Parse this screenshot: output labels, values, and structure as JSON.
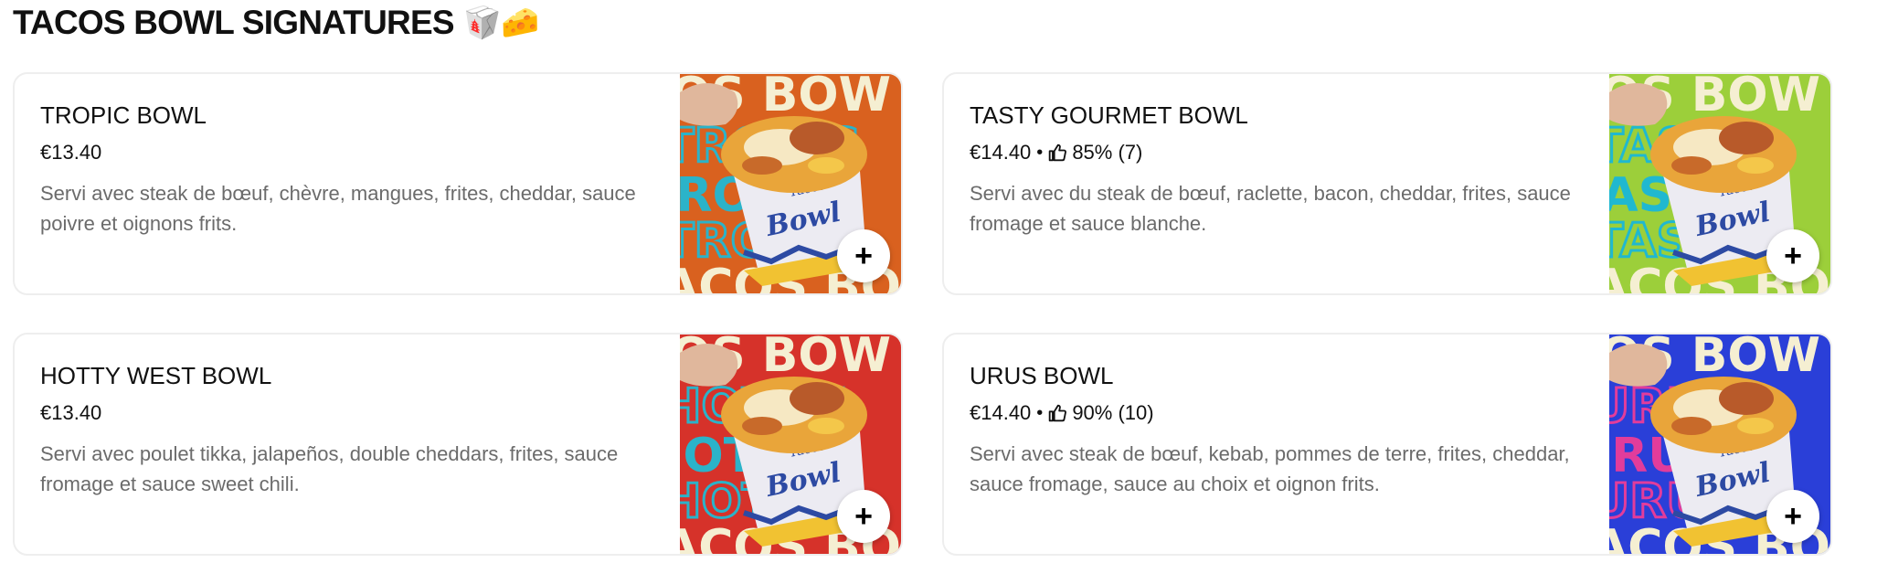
{
  "section": {
    "title": "TACOS BOWL SIGNATURES",
    "emoji": "🥡🧀"
  },
  "items": [
    {
      "name": "TROPIC BOWL",
      "price": "€13.40",
      "rating": "",
      "description": "Servi avec steak de bœuf, chèvre, mangues, frites, cheddar, sauce poivre et oignons frits.",
      "bg_color": "#d9611f",
      "text_color": "#2bb3c9",
      "image_word": "TROPIC",
      "add_label": "+"
    },
    {
      "name": "TASTY GOURMET BOWL",
      "price": "€14.40",
      "rating": "85% (7)",
      "description": "Servi avec du steak de bœuf, raclette, bacon, cheddar, frites, sauce fromage et sauce blanche.",
      "bg_color": "#9ccf3a",
      "text_color": "#20b8d0",
      "image_word": "TASTY",
      "add_label": "+"
    },
    {
      "name": "HOTTY WEST BOWL",
      "price": "€13.40",
      "rating": "",
      "description": "Servi avec poulet tikka, jalapeños, double cheddars, frites, sauce fromage et sauce sweet chili.",
      "bg_color": "#d6322a",
      "text_color": "#2bb3c9",
      "image_word": "HOTTY",
      "add_label": "+"
    },
    {
      "name": "URUS BOWL",
      "price": "€14.40",
      "rating": "90% (10)",
      "description": "Servi avec steak de bœuf, kebab, pommes de terre, frites, cheddar, sauce fromage, sauce au choix et oignon frits.",
      "bg_color": "#2a3fd8",
      "text_color": "#e23c9b",
      "image_word": "URUS",
      "add_label": "+"
    }
  ],
  "icons": {
    "thumbs_up": "thumbs-up-icon",
    "add": "plus-icon"
  }
}
